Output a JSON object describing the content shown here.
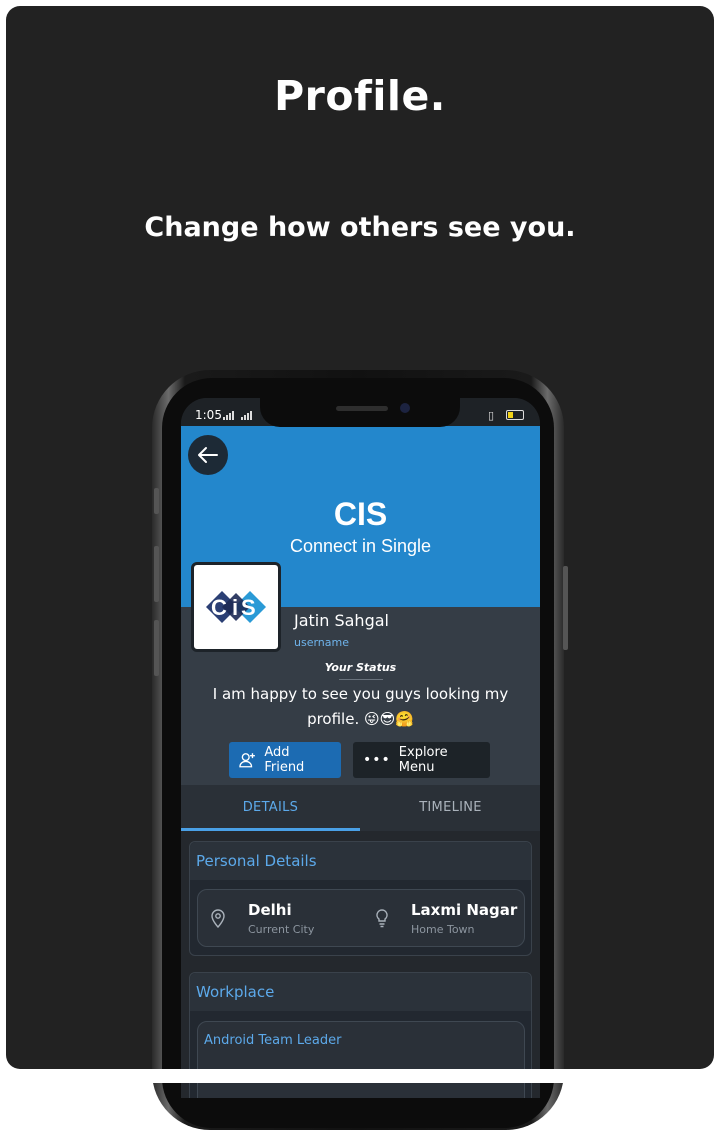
{
  "page": {
    "title": "Profile.",
    "subtitle": "Change how others see you."
  },
  "statusbar": {
    "time": "1:05"
  },
  "banner": {
    "app_name": "CIS",
    "tagline": "Connect in Single",
    "color": "#2387cc"
  },
  "profile": {
    "name": "Jatin Sahgal",
    "username": "username",
    "status_label": "Your Status",
    "status_text": "I am happy to see you guys looking my profile. 😜😎🤗",
    "logo_text": "CiS"
  },
  "actions": {
    "add_friend": "Add Friend",
    "explore_menu": "Explore Menu"
  },
  "tabs": [
    {
      "label": "DETAILS",
      "active": true
    },
    {
      "label": "TIMELINE",
      "active": false
    }
  ],
  "personal_details": {
    "heading": "Personal Details",
    "items": [
      {
        "value": "Delhi",
        "label": "Current City",
        "icon": "location-pin-icon"
      },
      {
        "value": "Laxmi Nagar",
        "label": "Home Town",
        "icon": "lightbulb-icon"
      }
    ]
  },
  "workplace": {
    "heading": "Workplace",
    "role": "Android Team Leader"
  }
}
